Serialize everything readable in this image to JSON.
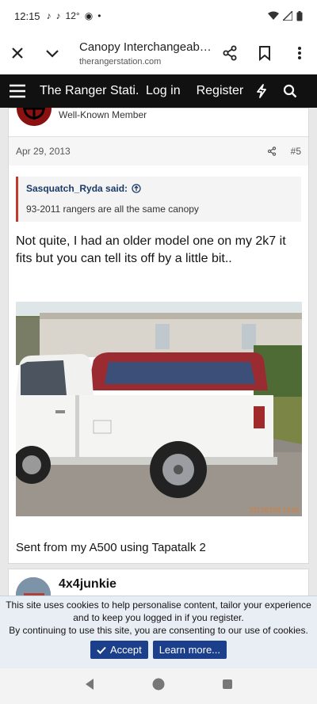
{
  "status": {
    "time": "12:15",
    "temp": "12°"
  },
  "browser": {
    "title": "Canopy Interchangeabili...",
    "url": "therangerstation.com"
  },
  "site_nav": {
    "brand": "The Ranger Stati...",
    "login": "Log in",
    "register": "Register"
  },
  "post": {
    "role": "Well-Known Member",
    "date": "Apr 29, 2013",
    "number": "#5",
    "quote_author": "Sasquatch_Ryda said:",
    "quote_text": "93-2011 rangers are all the same canopy",
    "body": "Not quite, I had an older model one on my 2k7 it fits but you can tell its off by a little bit..",
    "photo_timestamp": "2017/01/02 10:45",
    "signature": "Sent from my A500 using Tapatalk 2"
  },
  "next_post": {
    "username": "4x4junkie"
  },
  "cookie": {
    "line1": "This site uses cookies to help personalise content, tailor your experience",
    "line2": "and to keep you logged in if you register.",
    "line3": "By continuing to use this site, you are consenting to our use of cookies.",
    "accept": "Accept",
    "learn_more": "Learn more..."
  },
  "colors": {
    "nav_bg": "#111111",
    "accent_red": "#c0392b",
    "link_blue": "#1a3a6a",
    "button_blue": "#1c3f8c"
  },
  "icons": [
    "close-icon",
    "chevron-down-icon",
    "share-icon",
    "bookmark-icon",
    "more-icon",
    "menu-icon",
    "lightning-icon",
    "search-icon",
    "arrow-up-circle-icon",
    "check-icon",
    "back-icon",
    "home-icon",
    "recents-icon"
  ]
}
